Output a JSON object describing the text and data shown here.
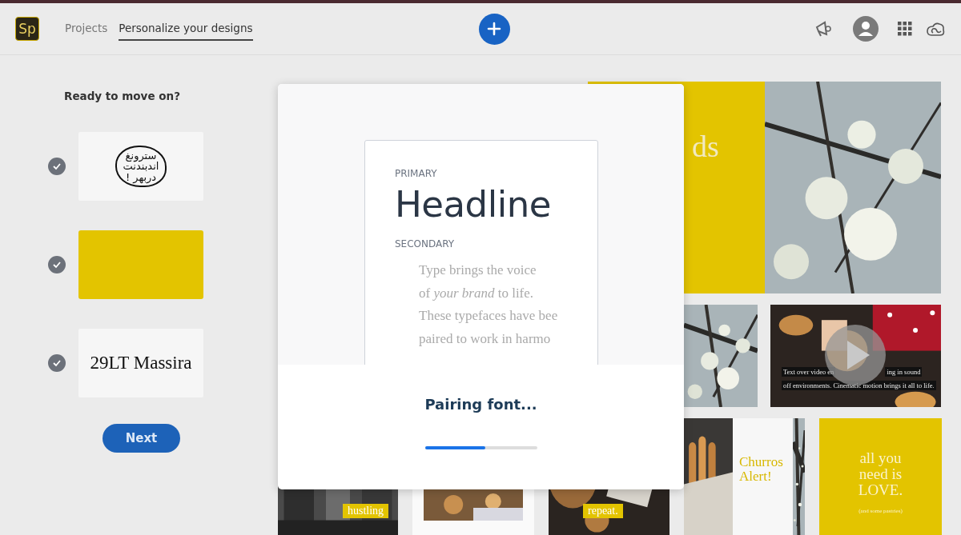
{
  "header": {
    "logo": "Sp",
    "tabs": [
      {
        "label": "Projects",
        "selected": false
      },
      {
        "label": "Personalize your designs",
        "selected": true
      }
    ]
  },
  "sidebar": {
    "title": "Ready to move on?",
    "items": [
      {
        "kind": "sticker",
        "lines": [
          "سترونغ",
          "اندبندنت",
          "دربهر !"
        ],
        "checked": true
      },
      {
        "kind": "swatch",
        "color": "#e3c400",
        "checked": true
      },
      {
        "kind": "font",
        "text": "29LT Massira",
        "checked": true
      }
    ],
    "button": "Next"
  },
  "gallery": {
    "rows": [
      [
        {
          "kind": "split",
          "text": "ds"
        }
      ],
      [
        {
          "kind": "blossom"
        },
        {
          "kind": "video",
          "caption_start": "Text over video en",
          "caption_end": "ing in sound",
          "caption_line": "off environments. Cinematic motion brings it all to life."
        }
      ],
      [
        {
          "kind": "city",
          "label": "hustling"
        },
        {
          "kind": "food"
        },
        {
          "kind": "bread",
          "label": "repeat."
        },
        {
          "kind": "churros",
          "text": "Churros Alert!"
        },
        {
          "kind": "love",
          "text": "all you need is LOVE.",
          "note": "(and some pastries)"
        }
      ]
    ]
  },
  "modal": {
    "primary_label": "PRIMARY",
    "headline": "Headline",
    "secondary_label": "SECONDARY",
    "sample_lines": [
      "Type brings the voice",
      "of *your brand* to life.",
      "These typefaces have bee",
      "paired to work in harmo"
    ],
    "status": "Pairing font...",
    "progress": {
      "level": 0.54
    }
  }
}
